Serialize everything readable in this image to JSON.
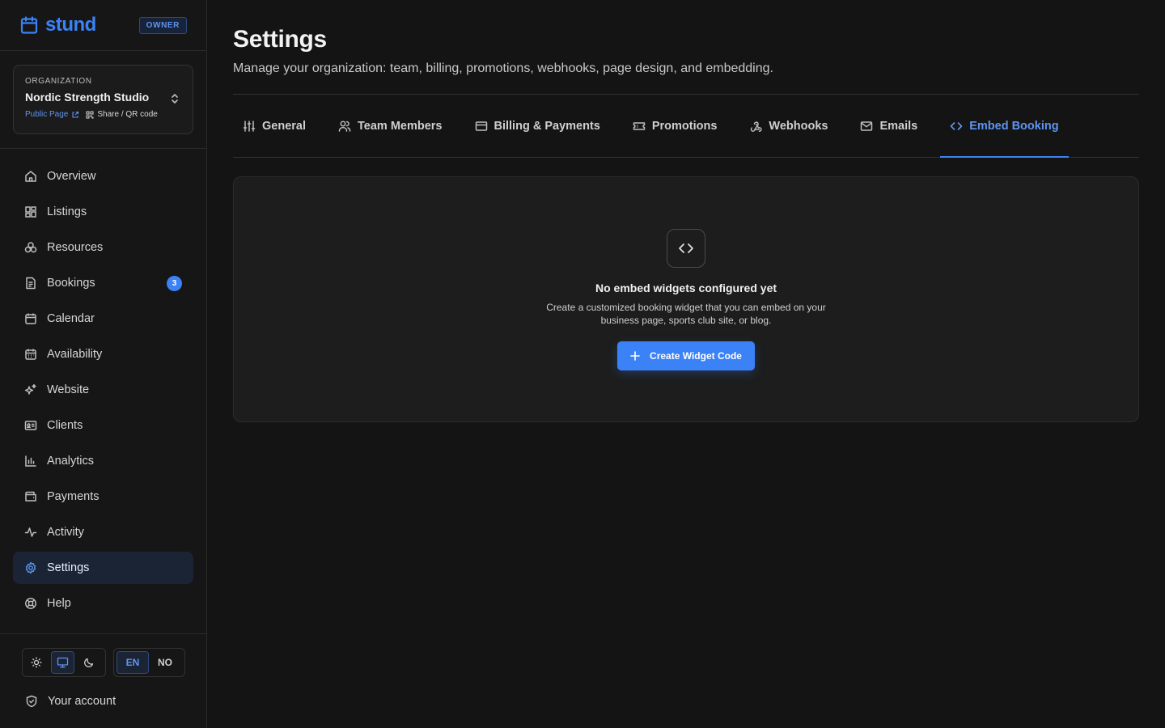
{
  "brand": {
    "name": "stund",
    "role_badge": "OWNER"
  },
  "organization": {
    "label": "ORGANIZATION",
    "name": "Nordic Strength Studio",
    "public_page": "Public Page",
    "share": "Share / QR code"
  },
  "nav": {
    "items": [
      {
        "label": "Overview",
        "icon": "home-icon"
      },
      {
        "label": "Listings",
        "icon": "grid-icon"
      },
      {
        "label": "Resources",
        "icon": "resources-icon"
      },
      {
        "label": "Bookings",
        "icon": "document-icon",
        "badge": "3"
      },
      {
        "label": "Calendar",
        "icon": "calendar-icon"
      },
      {
        "label": "Availability",
        "icon": "calendar-grid-icon"
      },
      {
        "label": "Website",
        "icon": "sparkles-icon"
      },
      {
        "label": "Clients",
        "icon": "id-card-icon"
      },
      {
        "label": "Analytics",
        "icon": "bar-chart-icon"
      },
      {
        "label": "Payments",
        "icon": "wallet-icon"
      },
      {
        "label": "Activity",
        "icon": "activity-icon"
      },
      {
        "label": "Settings",
        "icon": "gear-icon",
        "active": true
      },
      {
        "label": "Help",
        "icon": "lifebuoy-icon"
      }
    ]
  },
  "theme": {
    "selected": "system"
  },
  "language": {
    "en": "EN",
    "no": "NO",
    "selected": "EN"
  },
  "account": {
    "label": "Your account"
  },
  "page": {
    "title": "Settings",
    "subtitle": "Manage your organization: team, billing, promotions, webhooks, page design, and embedding."
  },
  "tabs": [
    {
      "label": "General",
      "icon": "sliders-icon"
    },
    {
      "label": "Team Members",
      "icon": "users-icon"
    },
    {
      "label": "Billing & Payments",
      "icon": "credit-card-icon"
    },
    {
      "label": "Promotions",
      "icon": "ticket-icon"
    },
    {
      "label": "Webhooks",
      "icon": "webhook-icon"
    },
    {
      "label": "Emails",
      "icon": "mail-icon"
    },
    {
      "label": "Embed Booking",
      "icon": "code-icon",
      "active": true
    }
  ],
  "empty_state": {
    "title": "No embed widgets configured yet",
    "description": "Create a customized booking widget that you can embed on your business page, sports club site, or blog.",
    "button": "Create Widget Code"
  },
  "colors": {
    "accent": "#3b82f6",
    "background": "#141414",
    "panel": "#1d1d1d"
  }
}
